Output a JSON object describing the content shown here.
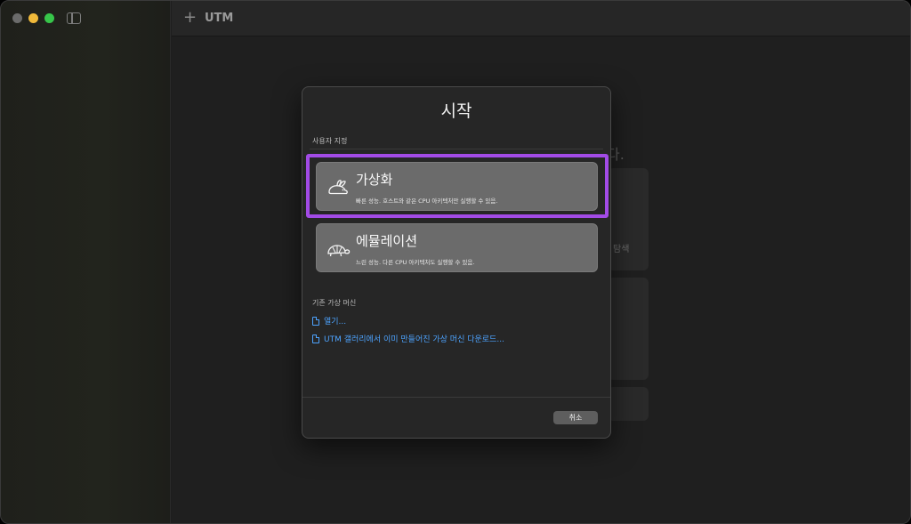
{
  "window": {
    "toolbar": {
      "title": "UTM",
      "add_icon": "plus-icon"
    }
  },
  "background": {
    "heading_tail": "다.",
    "card_label": "탐색"
  },
  "dialog": {
    "title": "시작",
    "custom_section_label": "사용자 지정",
    "options": [
      {
        "title": "가상화",
        "description": "빠른 성능. 호스트와 같은 CPU 아키텍처만 실행할 수 있음.",
        "icon": "rabbit-icon",
        "selected": true
      },
      {
        "title": "에뮬레이션",
        "description": "느린 성능. 다른 CPU 아키텍처도 실행할 수 있음.",
        "icon": "turtle-icon",
        "selected": false
      }
    ],
    "existing_section_label": "기존 가상 머신",
    "links": {
      "open": "열기...",
      "gallery": "UTM 갤러리에서 이미 만들어진 가상 머신 다운로드..."
    },
    "cancel_label": "취소"
  },
  "colors": {
    "highlight": "#a24be6",
    "link": "#4da3ff"
  }
}
